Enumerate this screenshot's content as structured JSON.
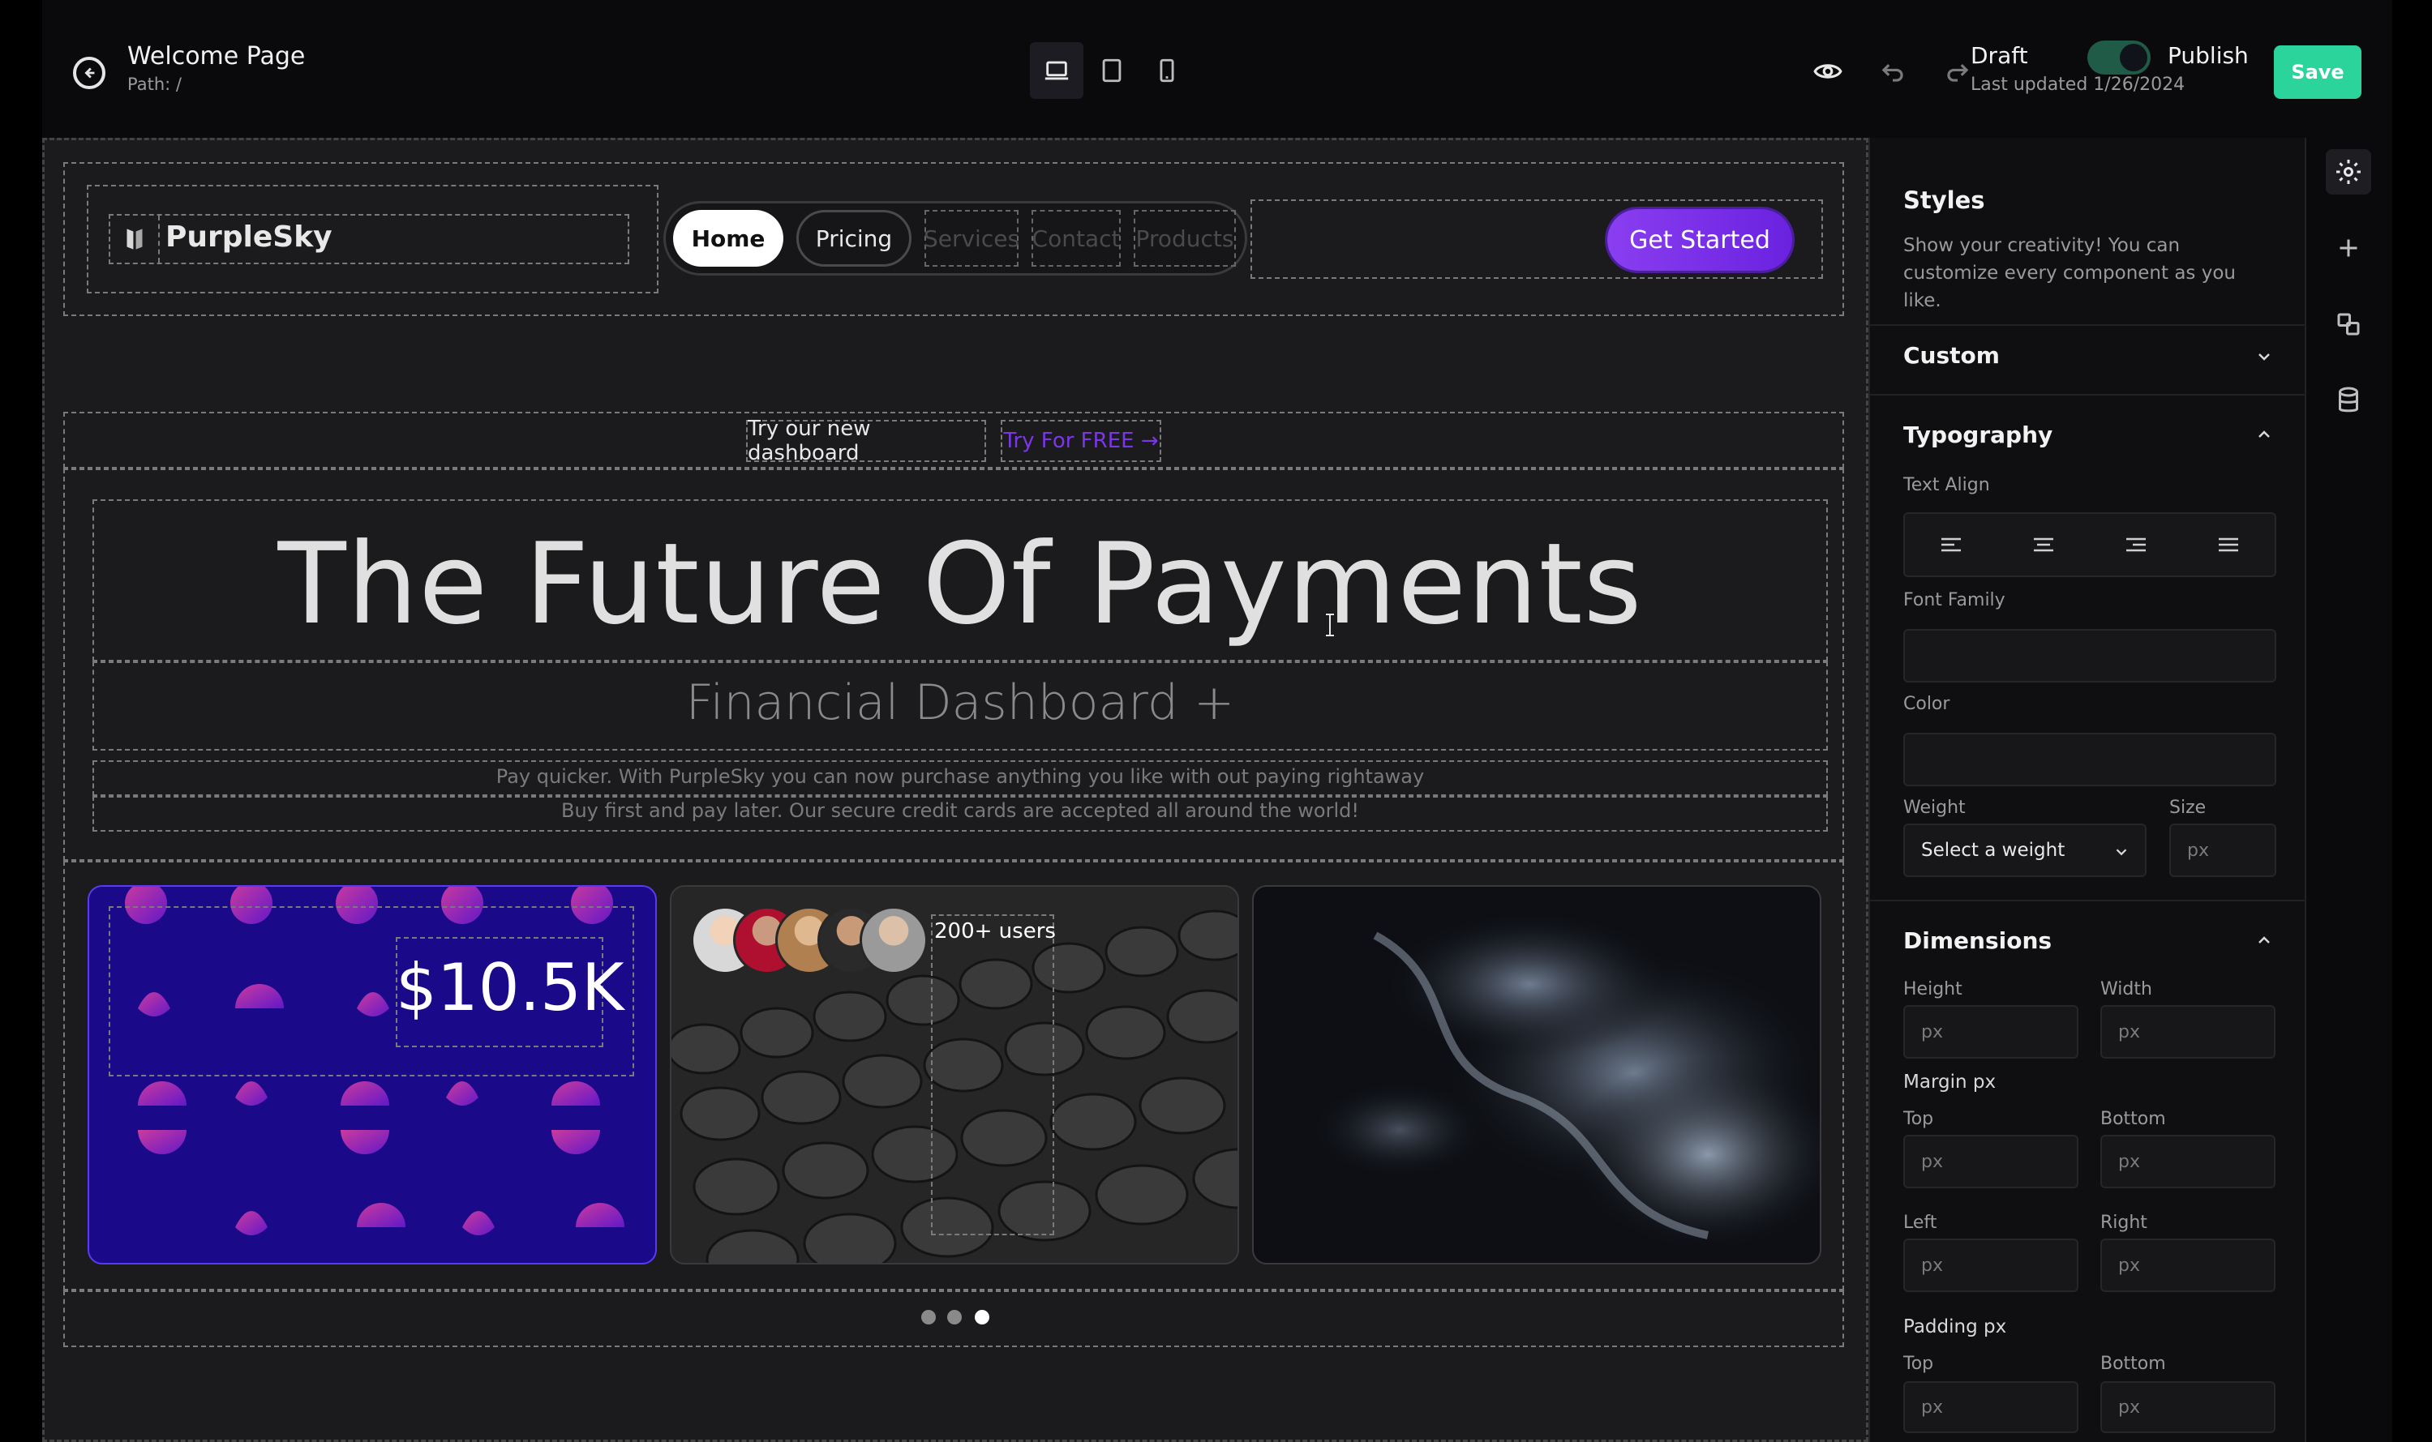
{
  "topbar": {
    "title": "Welcome Page",
    "path": "Path: /",
    "draft_label": "Draft",
    "publish_label": "Publish",
    "last_updated": "Last updated 1/26/2024",
    "save_label": "Save"
  },
  "site": {
    "brand": "PurpleSky",
    "nav": [
      "Home",
      "Pricing",
      "Services",
      "Contact",
      "Products"
    ],
    "cta": "Get Started",
    "announcement": "Try our new dashboard",
    "announcement_link": "Try For FREE →",
    "hero_title": "The Future Of Payments",
    "hero_subtitle": "Financial Dashboard +",
    "hero_desc_1": "Pay quicker. With PurpleSky you can now purchase anything you like with out paying rightaway",
    "hero_desc_2": "Buy first and pay later. Our secure credit cards are accepted all around the world!",
    "stat_value": "$10.5K",
    "users_label": "200+ users",
    "carousel_active_index": 2
  },
  "panel": {
    "styles_title": "Styles",
    "styles_desc": "Show your creativity! You can customize every component as you like.",
    "custom_title": "Custom",
    "typography_title": "Typography",
    "text_align_label": "Text Align",
    "font_family_label": "Font Family",
    "color_label": "Color",
    "weight_label": "Weight",
    "weight_placeholder": "Select a weight",
    "size_label": "Size",
    "dimensions_title": "Dimensions",
    "height_label": "Height",
    "width_label": "Width",
    "margin_label": "Margin px",
    "padding_label": "Padding px",
    "top_label": "Top",
    "bottom_label": "Bottom",
    "left_label": "Left",
    "right_label": "Right",
    "unit": "px"
  },
  "colors": {
    "accent_green": "#2ad49a",
    "brand_purple": "#7b36e8"
  }
}
